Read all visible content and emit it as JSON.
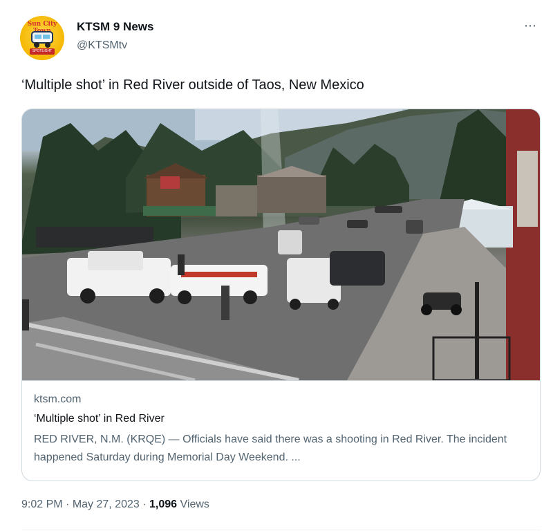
{
  "author": {
    "name": "KTSM 9 News",
    "handle": "@KTSMtv",
    "avatar_text": "Sun City Town",
    "avatar_subtext": "SPOTLIGHT"
  },
  "menu": {
    "more_icon": "⋯"
  },
  "tweet": {
    "text": "‘Multiple shot’ in Red River outside of Taos, New Mexico"
  },
  "card": {
    "domain": "ktsm.com",
    "title": "‘Multiple shot’ in Red River",
    "description": "RED RIVER, N.M. (KRQE) — Officials have said there was a shooting in Red River. The incident happened Saturday during Memorial Day Weekend. ..."
  },
  "footer": {
    "time": "9:02 PM",
    "separator": "·",
    "date": "May 27, 2023",
    "views_count": "1,096",
    "views_label": "Views"
  }
}
